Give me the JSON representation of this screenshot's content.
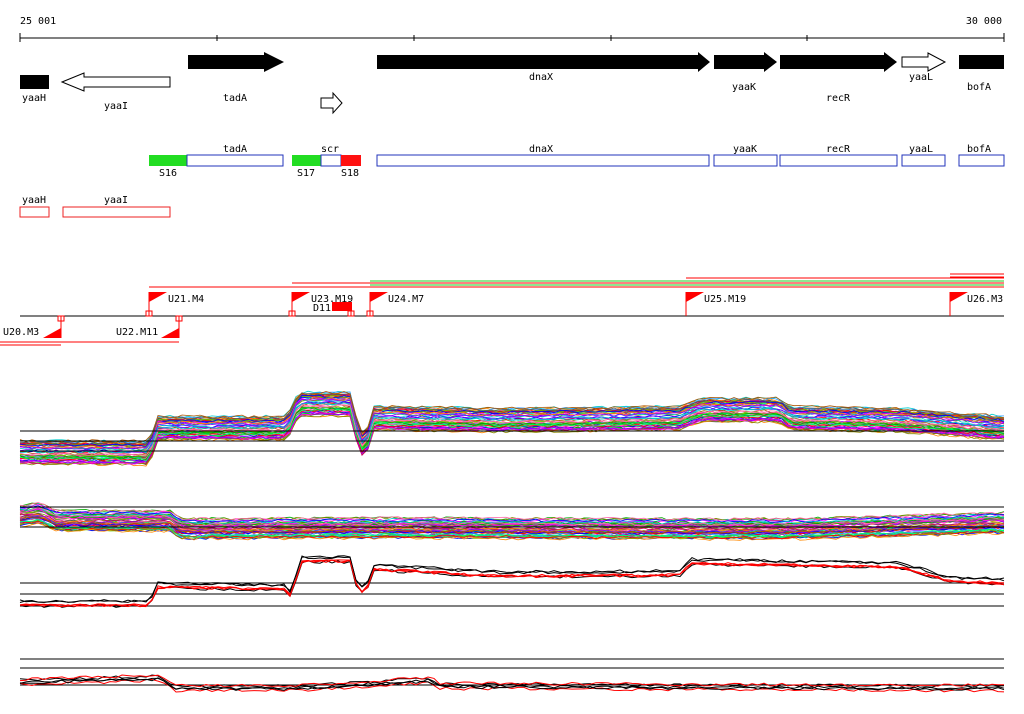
{
  "ruler": {
    "start_label": "25 001",
    "end_label": "30 000",
    "start": 25001,
    "end": 30000
  },
  "colors": {
    "gene": "#000000",
    "utr_green": "#22dd22",
    "utr_red": "#ff1111",
    "annotation_blue": "#2233bb",
    "annotation_red": "#ee2222",
    "marker_red": "#ff0000"
  },
  "genes": [
    {
      "name": "yaaH",
      "strand": "-",
      "filled": true
    },
    {
      "name": "yaaI",
      "strand": "-",
      "filled": false
    },
    {
      "name": "tadA",
      "strand": "+",
      "filled": true
    },
    {
      "name": "",
      "strand": "+",
      "filled": false
    },
    {
      "name": "dnaX",
      "strand": "+",
      "filled": true
    },
    {
      "name": "yaaK",
      "strand": "+",
      "filled": true
    },
    {
      "name": "recR",
      "strand": "+",
      "filled": true
    },
    {
      "name": "yaaL",
      "strand": "+",
      "filled": false
    },
    {
      "name": "bofA",
      "strand": "+",
      "filled": true
    }
  ],
  "transcripts_top": [
    {
      "label": "tadA",
      "type": "blue"
    },
    {
      "label": "scr",
      "type": "blue"
    },
    {
      "label": "dnaX",
      "type": "blue"
    },
    {
      "label": "yaaK",
      "type": "blue"
    },
    {
      "label": "recR",
      "type": "blue"
    },
    {
      "label": "yaaL",
      "type": "blue"
    },
    {
      "label": "bofA",
      "type": "blue"
    }
  ],
  "utr_segments": [
    {
      "label": "S16",
      "color": "green"
    },
    {
      "label": "S17",
      "color": "green"
    },
    {
      "label": "S18",
      "color": "red"
    }
  ],
  "transcripts_bottom": [
    {
      "label": "yaaH"
    },
    {
      "label": "yaaI"
    }
  ],
  "markers_up": [
    {
      "label": "U21.M4"
    },
    {
      "label": "U23.M19"
    },
    {
      "label": "U24.M7"
    },
    {
      "label": "U25.M19"
    },
    {
      "label": "U26.M3"
    }
  ],
  "markers_down": [
    {
      "label": "U20.M3"
    },
    {
      "label": "U22.M11"
    }
  ],
  "marker_extra": {
    "label": "D11"
  }
}
